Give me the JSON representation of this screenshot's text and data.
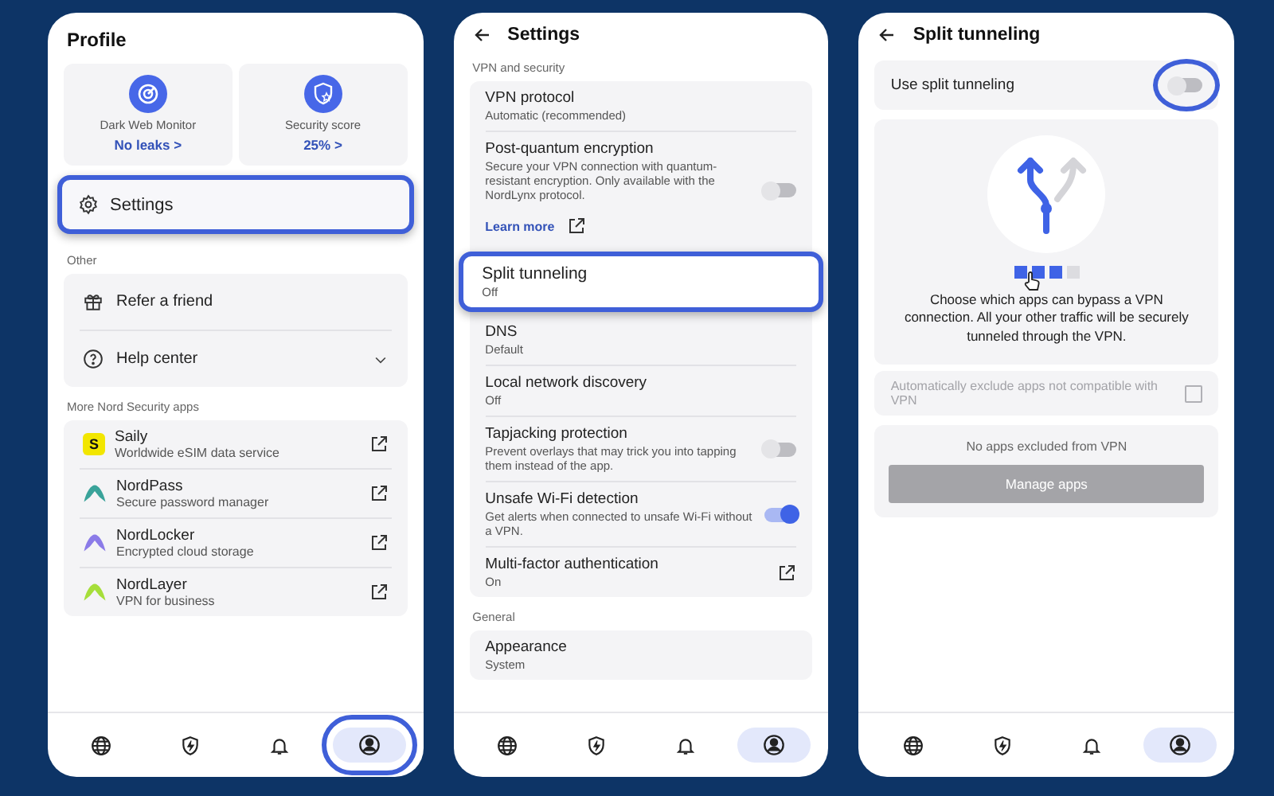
{
  "profile": {
    "title": "Profile",
    "cards": [
      {
        "kind": "radar",
        "label": "Dark Web Monitor",
        "value": "No leaks >"
      },
      {
        "kind": "shield_star",
        "label": "Security score",
        "value": "25% >"
      }
    ],
    "settings_item": {
      "label": "Settings",
      "highlighted": true
    },
    "other_heading": "Other",
    "other_items": [
      {
        "kind": "gift",
        "label": "Refer a friend"
      },
      {
        "kind": "help",
        "label": "Help center"
      }
    ],
    "apps_heading": "More Nord Security apps",
    "apps": [
      {
        "kind": "letter",
        "logo_text": "S",
        "color": "#f2e600",
        "name": "Saily",
        "description": "Worldwide eSIM data service"
      },
      {
        "kind": "arc",
        "color": "#3aa39a",
        "name": "NordPass",
        "description": "Secure password manager"
      },
      {
        "kind": "arc",
        "color": "#8b7be8",
        "name": "NordLocker",
        "description": "Encrypted cloud storage"
      },
      {
        "kind": "arc",
        "color": "#a6de3a",
        "name": "NordLayer",
        "description": "VPN for business"
      }
    ],
    "nav": [
      {
        "kind": "globe",
        "selected": false,
        "highlighted": false
      },
      {
        "kind": "shield",
        "selected": false,
        "highlighted": false
      },
      {
        "kind": "bell",
        "selected": false,
        "highlighted": false
      },
      {
        "kind": "person",
        "selected": true,
        "highlighted": true
      }
    ]
  },
  "settings": {
    "title": "Settings",
    "sections": [
      {
        "heading": "VPN and security",
        "rows": [
          {
            "kind": "value",
            "title": "VPN protocol",
            "value": "Automatic (recommended)",
            "highlighted": false
          },
          {
            "kind": "toggle",
            "title": "Post-quantum encryption",
            "description": "Secure your VPN connection with quantum-resistant encryption. Only available with the NordLynx protocol.",
            "on": false,
            "link": "Learn more",
            "highlighted": false
          },
          {
            "kind": "value",
            "title": "Split tunneling",
            "value": "Off",
            "highlighted": true
          },
          {
            "kind": "value",
            "title": "DNS",
            "value": "Default",
            "highlighted": false
          },
          {
            "kind": "value",
            "title": "Local network discovery",
            "value": "Off",
            "highlighted": false
          },
          {
            "kind": "toggle",
            "title": "Tapjacking protection",
            "description": "Prevent overlays that may trick you into tapping them instead of the app.",
            "on": false,
            "highlighted": false
          },
          {
            "kind": "toggle",
            "title": "Unsafe Wi-Fi detection",
            "description": "Get alerts when connected to unsafe Wi-Fi without a VPN.",
            "on": true,
            "highlighted": false
          },
          {
            "kind": "external",
            "title": "Multi-factor authentication",
            "value": "On",
            "highlighted": false
          }
        ]
      },
      {
        "heading": "General",
        "rows": [
          {
            "kind": "value",
            "title": "Appearance",
            "value": "System",
            "highlighted": false
          }
        ]
      }
    ],
    "nav": [
      {
        "kind": "globe",
        "selected": false,
        "highlighted": false
      },
      {
        "kind": "shield",
        "selected": false,
        "highlighted": false
      },
      {
        "kind": "bell",
        "selected": false,
        "highlighted": false
      },
      {
        "kind": "person",
        "selected": true,
        "highlighted": false
      }
    ]
  },
  "split_tunneling": {
    "title": "Split tunneling",
    "switch": {
      "label": "Use split tunneling",
      "on": false,
      "highlighted": true
    },
    "pages": [
      {
        "active": true
      },
      {
        "active": true
      },
      {
        "active": true
      },
      {
        "active": false
      }
    ],
    "intro": "Choose which apps can bypass a VPN connection. All your other traffic will be securely tunneled through the VPN.",
    "auto_exclude": {
      "label": "Automatically exclude apps not compatible with VPN",
      "checked": false,
      "disabled": true
    },
    "empty_text": "No apps excluded from VPN",
    "manage_button": {
      "label": "Manage apps",
      "disabled": true
    },
    "nav": [
      {
        "kind": "globe",
        "selected": false,
        "highlighted": false
      },
      {
        "kind": "shield",
        "selected": false,
        "highlighted": false
      },
      {
        "kind": "bell",
        "selected": false,
        "highlighted": false
      },
      {
        "kind": "person",
        "selected": true,
        "highlighted": false
      }
    ]
  }
}
